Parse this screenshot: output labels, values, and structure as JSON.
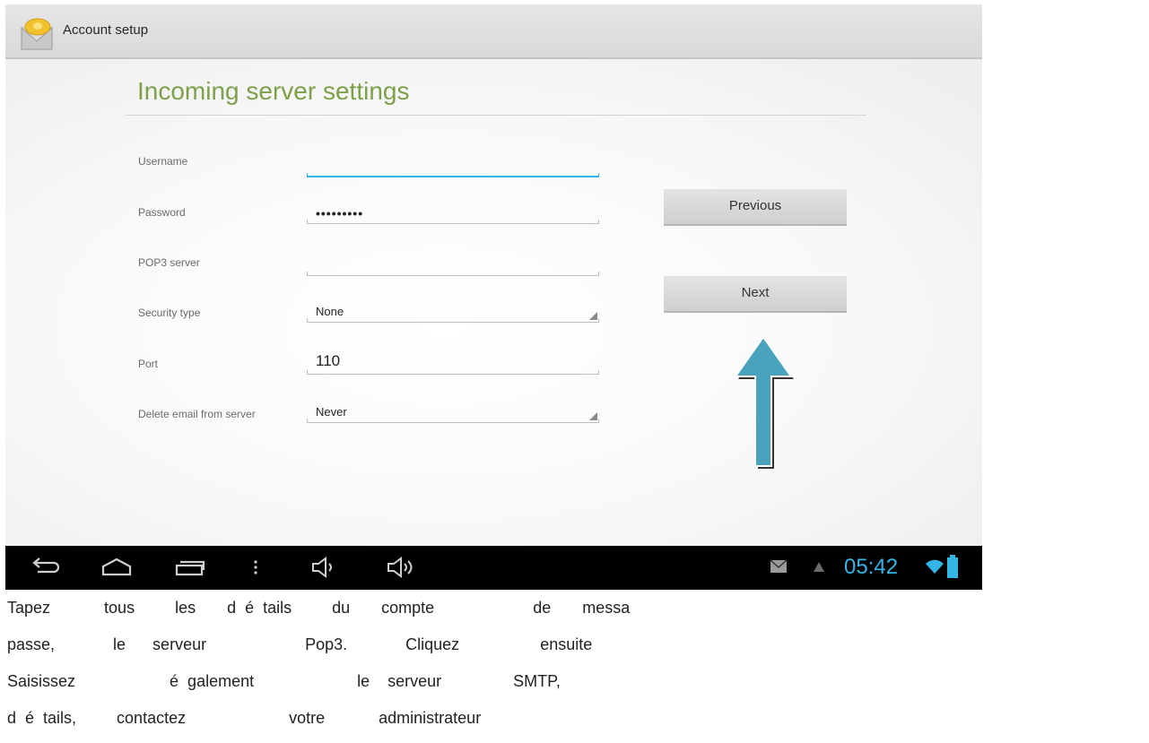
{
  "action_bar": {
    "title": "Account setup",
    "icon": "email-envelope-icon"
  },
  "form": {
    "section_title": "Incoming server settings",
    "username": {
      "label": "Username",
      "value": ""
    },
    "password": {
      "label": "Password",
      "value": "•••••••••"
    },
    "pop3_server": {
      "label": "POP3 server",
      "value": ""
    },
    "security_type": {
      "label": "Security type",
      "value": "None"
    },
    "port": {
      "label": "Port",
      "value": "110"
    },
    "delete_email": {
      "label": "Delete email from server",
      "value": "Never"
    }
  },
  "buttons": {
    "previous": "Previous",
    "next": "Next"
  },
  "system_bar": {
    "clock": "05:42",
    "accent": "#33b5e5"
  },
  "caption": {
    "lines": [
      "Tapez            tous         les       d  é  tails         du       compte                      de       messa",
      "passe,             le      serveur                      Pop3.             Cliquez                  ensuite",
      "Saisissez                     é  galement                       le    serveur                SMTP,",
      "d  é  tails,         contactez                       votre            administrateur"
    ]
  }
}
